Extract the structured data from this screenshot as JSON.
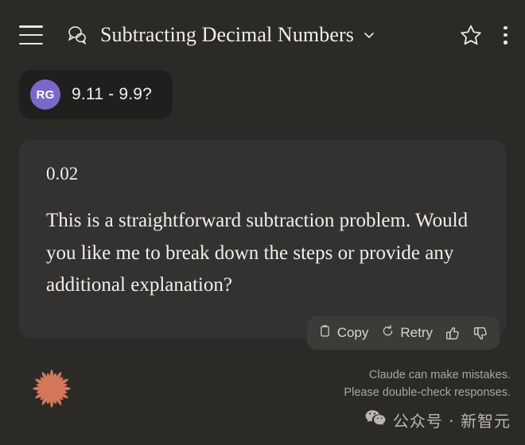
{
  "header": {
    "menu_icon": "hamburger-menu-icon",
    "chat_icon": "chat-bubbles-icon",
    "title": "Subtracting Decimal Numbers",
    "chevron_icon": "chevron-down-icon",
    "star_icon": "star-outline-icon",
    "more_icon": "more-vertical-icon"
  },
  "conversation": {
    "user_message": {
      "avatar_initials": "RG",
      "avatar_color": "#7a68c9",
      "text": "9.11 - 9.9?"
    },
    "assistant_message": {
      "answer": "0.02",
      "body": "This is a straightforward subtraction problem. Would you like me to break down the steps or provide any additional explanation?"
    },
    "actions": {
      "copy_label": "Copy",
      "copy_icon": "clipboard-icon",
      "retry_label": "Retry",
      "retry_icon": "refresh-icon",
      "thumbs_up_icon": "thumbs-up-icon",
      "thumbs_down_icon": "thumbs-down-icon"
    }
  },
  "footer": {
    "logo_icon": "claude-starburst-logo",
    "logo_color": "#d3775a",
    "disclaimer_line1": "Claude can make mistakes.",
    "disclaimer_line2": "Please double-check responses.",
    "watermark_icon": "wechat-icon",
    "watermark_text": "公众号 · 新智元"
  }
}
